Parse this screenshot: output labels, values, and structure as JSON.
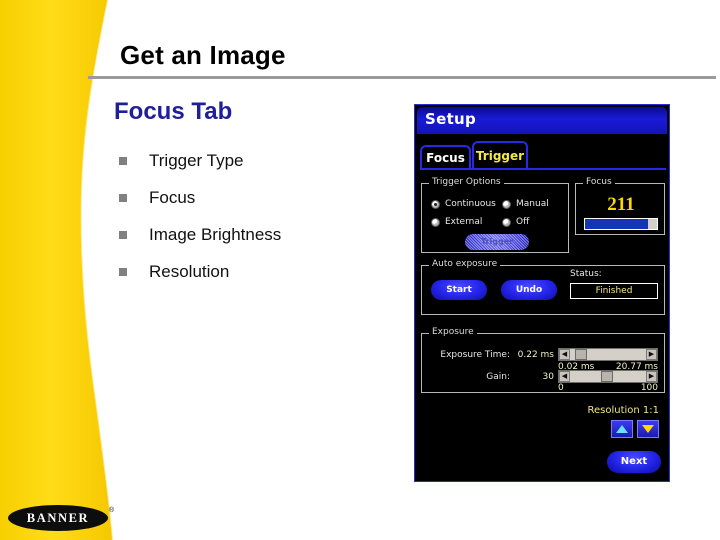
{
  "slide": {
    "title": "Get an Image",
    "heading": "Focus Tab",
    "bullets": [
      {
        "label": "Trigger Type"
      },
      {
        "label": "Focus"
      },
      {
        "label": "Image Brightness"
      },
      {
        "label": "Resolution"
      }
    ]
  },
  "logo": {
    "text": "BANNER",
    "registered": "®"
  },
  "dialog": {
    "title": "Setup",
    "tabs": [
      {
        "label": "Focus"
      },
      {
        "label": "Trigger"
      }
    ],
    "trigger_options": {
      "legend": "Trigger Options",
      "radios": [
        {
          "label": "Continuous",
          "selected": true
        },
        {
          "label": "Manual",
          "selected": false
        },
        {
          "label": "External",
          "selected": false
        },
        {
          "label": "Off",
          "selected": false
        }
      ],
      "trigger_button": "Trigger"
    },
    "focus": {
      "legend": "Focus",
      "value": "211",
      "bar_percent": "87"
    },
    "auto_exposure": {
      "legend": "Auto exposure",
      "start_label": "Start",
      "undo_label": "Undo",
      "status_label": "Status:",
      "status_value": "Finished"
    },
    "exposure": {
      "legend": "Exposure",
      "time_label": "Exposure Time:",
      "time_value": "0.22 ms",
      "time_min": "0.02 ms",
      "time_max": "20.77 ms",
      "gain_label": "Gain:",
      "gain_value": "30",
      "gain_min": "0",
      "gain_max": "100"
    },
    "resolution_label": "Resolution 1:1",
    "next_label": "Next"
  },
  "colors": {
    "accent_yellow": "#ffd400",
    "heading_blue": "#1f1f9b",
    "dialog_blue": "#2a2ae6",
    "value_yellow": "#ffd700"
  }
}
